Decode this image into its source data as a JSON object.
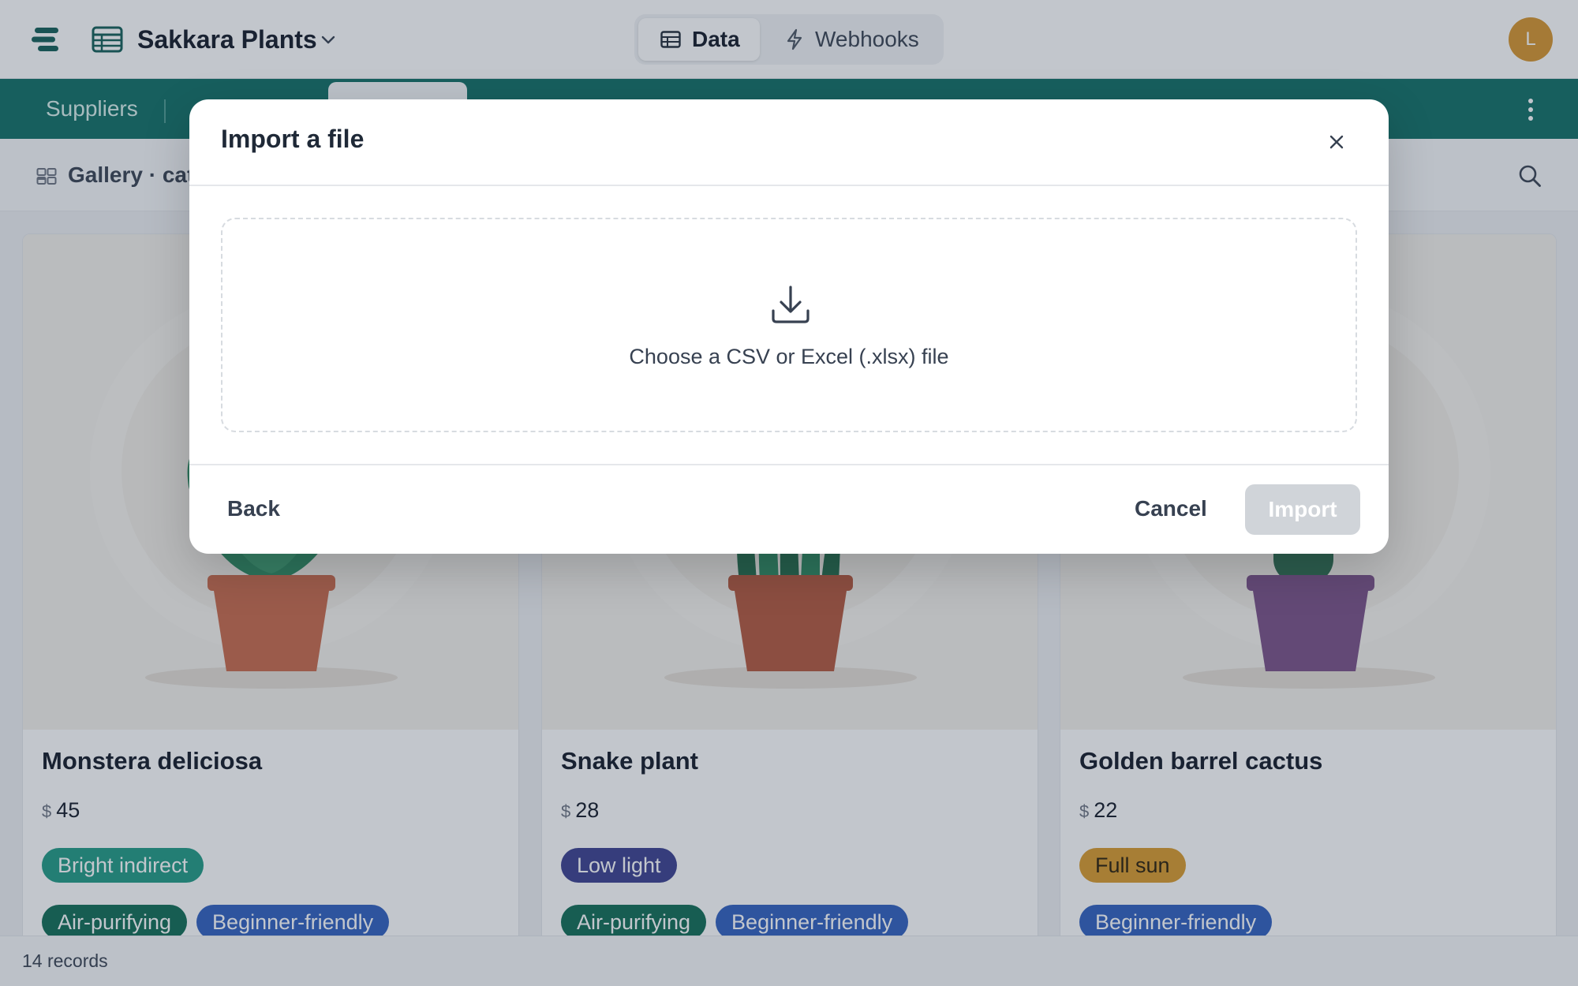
{
  "header": {
    "base_title": "Sakkara Plants",
    "tabs": [
      {
        "label": "Data",
        "icon": "table-icon",
        "active": true
      },
      {
        "label": "Webhooks",
        "icon": "lightning-icon",
        "active": false
      }
    ],
    "avatar_initial": "L",
    "avatar_color": "#d6952c"
  },
  "tables": {
    "items": [
      "Suppliers"
    ],
    "bar_color": "#0f6f64"
  },
  "view": {
    "name": "Gallery · cata"
  },
  "gallery": {
    "cards": [
      {
        "title": "Monstera deliciosa",
        "currency": "$",
        "price": "45",
        "light": {
          "label": "Bright indirect",
          "color": "#1f9a83"
        },
        "tags": [
          {
            "label": "Air-purifying",
            "color": "#0f6b53"
          },
          {
            "label": "Beginner-friendly",
            "color": "#2f5fbf"
          }
        ],
        "pot_color": "#c9694a"
      },
      {
        "title": "Snake plant",
        "currency": "$",
        "price": "28",
        "light": {
          "label": "Low light",
          "color": "#3a3f8f"
        },
        "tags": [
          {
            "label": "Air-purifying",
            "color": "#0f6b53"
          },
          {
            "label": "Beginner-friendly",
            "color": "#2f5fbf"
          }
        ],
        "pot_color": "#b4573c"
      },
      {
        "title": "Golden barrel cactus",
        "currency": "$",
        "price": "22",
        "light": {
          "label": "Full sun",
          "color": "#d99a2b",
          "text_color": "#2a1d07"
        },
        "tags": [
          {
            "label": "Beginner-friendly",
            "color": "#2f5fbf"
          }
        ],
        "pot_color": "#7a4f86"
      }
    ]
  },
  "footer": {
    "records": "14 records"
  },
  "modal": {
    "title": "Import a file",
    "dropzone_text": "Choose a CSV or Excel (.xlsx) file",
    "back_label": "Back",
    "cancel_label": "Cancel",
    "import_label": "Import",
    "import_disabled": true
  }
}
